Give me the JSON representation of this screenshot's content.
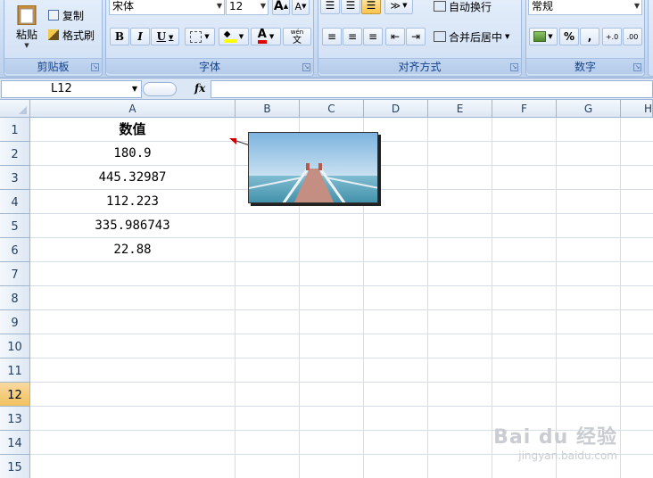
{
  "ribbon": {
    "clipboard": {
      "paste_label": "粘贴",
      "copy_label": "复制",
      "format_painter_label": "格式刷",
      "group_label": "剪贴板"
    },
    "font": {
      "font_name": "宋体",
      "font_size": "12",
      "bold_label": "B",
      "italic_label": "I",
      "underline_label": "U",
      "font_color_letter": "A",
      "grow_label": "A",
      "shrink_label": "A",
      "phonetic_label": "wén",
      "phonetic_char": "文",
      "group_label": "字体"
    },
    "alignment": {
      "wrap_label": "自动换行",
      "merge_label": "合并后居中",
      "group_label": "对齐方式"
    },
    "number": {
      "format_value": "常规",
      "percent_label": "%",
      "comma_label": ",",
      "inc_decimal_label": "+.0",
      "dec_decimal_label": ".00",
      "group_label": "数字"
    }
  },
  "formula_bar": {
    "name_box": "L12",
    "fx_label": "fx"
  },
  "sheet": {
    "columns": [
      "A",
      "B",
      "C",
      "D",
      "E",
      "F",
      "G",
      "H"
    ],
    "rows": [
      "1",
      "2",
      "3",
      "4",
      "5",
      "6",
      "7",
      "8",
      "9",
      "10",
      "11",
      "12",
      "13",
      "14",
      "15"
    ],
    "active_row": "12",
    "column_a": [
      "数值",
      "180.9",
      "445.32987",
      "112.223",
      "335.986743",
      "22.88"
    ]
  },
  "watermark": {
    "brand_text": "Bai du 经验",
    "url_text": "jingyan.baidu.com"
  }
}
